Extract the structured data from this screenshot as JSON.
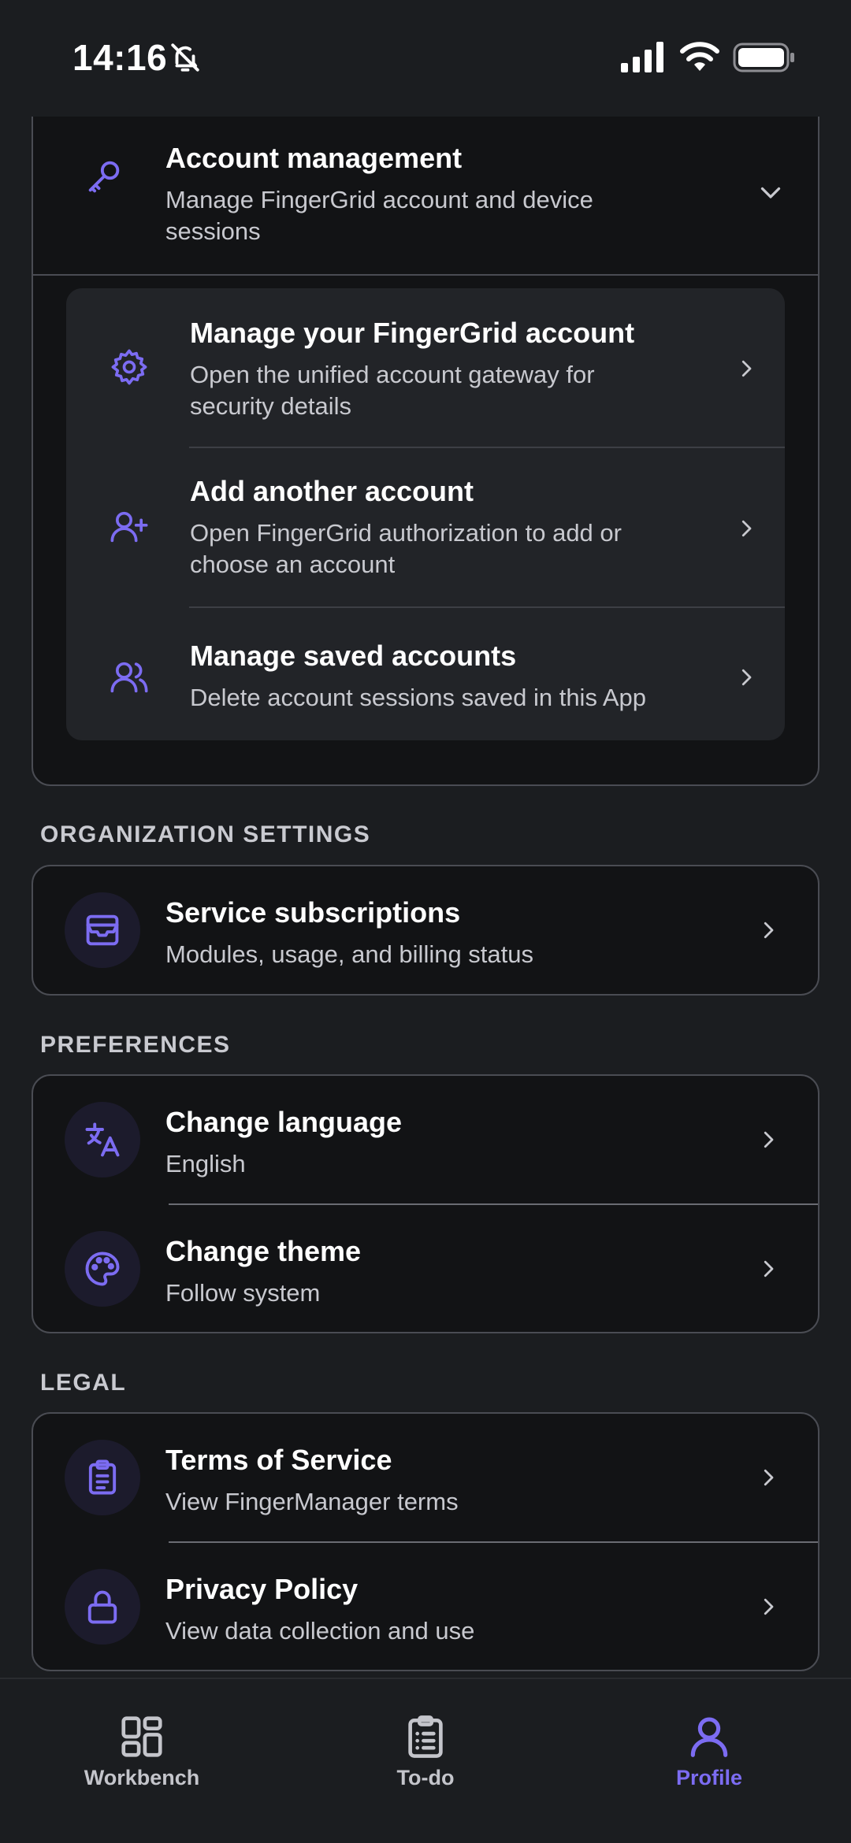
{
  "status_bar": {
    "time": "14:16"
  },
  "colors": {
    "accent": "#7c6cf2",
    "background": "#1b1d20",
    "card": "#121315"
  },
  "account_management": {
    "title": "Account management",
    "subtitle_line1": "Manage FingerGrid account and device",
    "subtitle_line2": "sessions",
    "icon": "key-icon",
    "items": [
      {
        "title": "Manage your FingerGrid account",
        "subtitle_line1": "Open the unified account gateway for",
        "subtitle_line2": "security details",
        "icon": "gear-icon"
      },
      {
        "title": "Add another account",
        "subtitle_line1": "Open FingerGrid authorization to add or",
        "subtitle_line2": "choose an account",
        "icon": "user-plus-icon"
      },
      {
        "title": "Manage saved accounts",
        "subtitle_line1": "Delete account sessions saved in this App",
        "icon": "users-icon"
      }
    ]
  },
  "organization": {
    "header": "ORGANIZATION SETTINGS",
    "items": [
      {
        "title": "Service subscriptions",
        "subtitle": "Modules, usage, and billing status",
        "icon": "inbox-icon"
      }
    ]
  },
  "preferences": {
    "header": "PREFERENCES",
    "items": [
      {
        "title": "Change language",
        "subtitle": "English",
        "icon": "translate-icon"
      },
      {
        "title": "Change theme",
        "subtitle": "Follow system",
        "icon": "palette-icon"
      }
    ]
  },
  "legal": {
    "header": "LEGAL",
    "items": [
      {
        "title": "Terms of Service",
        "subtitle": "View FingerManager terms",
        "icon": "clipboard-icon"
      },
      {
        "title": "Privacy Policy",
        "subtitle": "View data collection and use",
        "icon": "lock-icon"
      }
    ]
  },
  "bottom_nav": {
    "items": [
      {
        "label": "Workbench",
        "icon": "grid-icon",
        "active": false
      },
      {
        "label": "To-do",
        "icon": "checklist-icon",
        "active": false
      },
      {
        "label": "Profile",
        "icon": "person-icon",
        "active": true
      }
    ]
  }
}
